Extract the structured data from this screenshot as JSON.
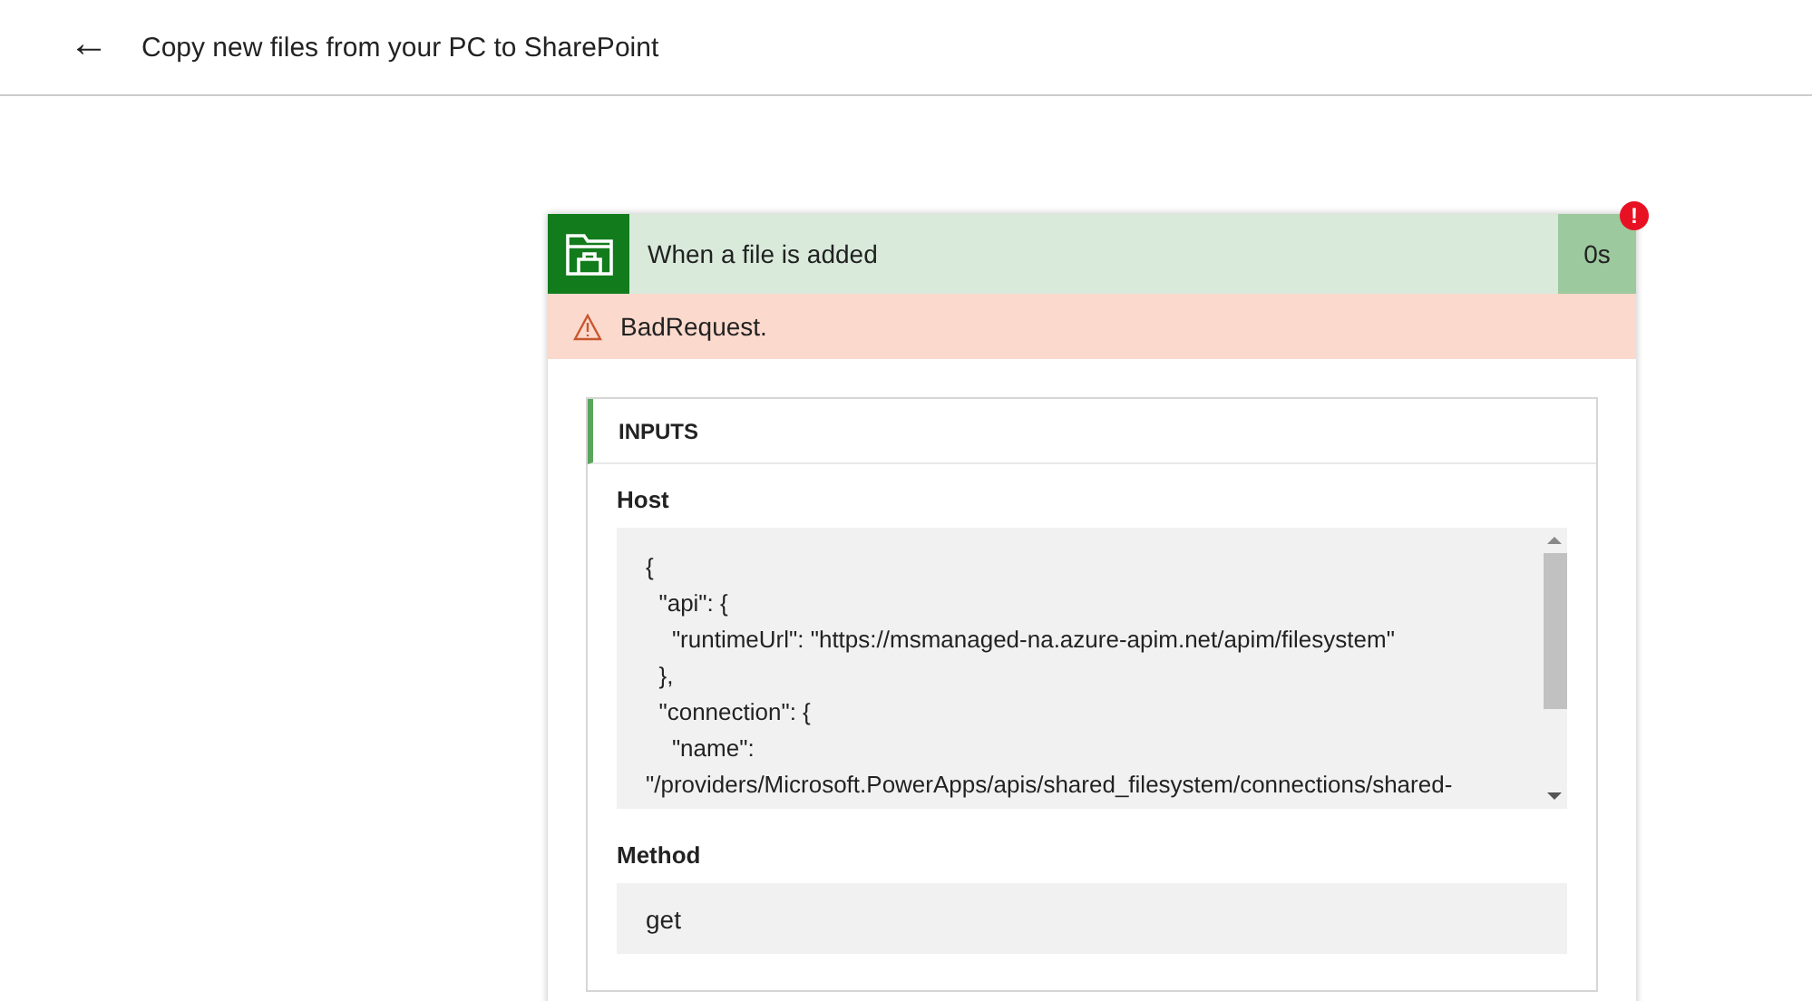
{
  "header": {
    "back_icon": "←",
    "title": "Copy new files from your PC to SharePoint"
  },
  "card": {
    "title": "When a file is added",
    "duration": "0s",
    "error_badge": "!",
    "error": {
      "text": "BadRequest."
    },
    "inputs": {
      "heading": "INPUTS",
      "fields": [
        {
          "label": "Host",
          "kind": "code",
          "lines": [
            "{",
            "  \"api\": {",
            "    \"runtimeUrl\": \"https://msmanaged-na.azure-apim.net/apim/filesystem\"",
            "  },",
            "  \"connection\": {",
            "    \"name\":",
            "\"/providers/Microsoft.PowerApps/apis/shared_filesystem/connections/shared-"
          ]
        },
        {
          "label": "Method",
          "kind": "value",
          "value": "get"
        }
      ]
    }
  }
}
